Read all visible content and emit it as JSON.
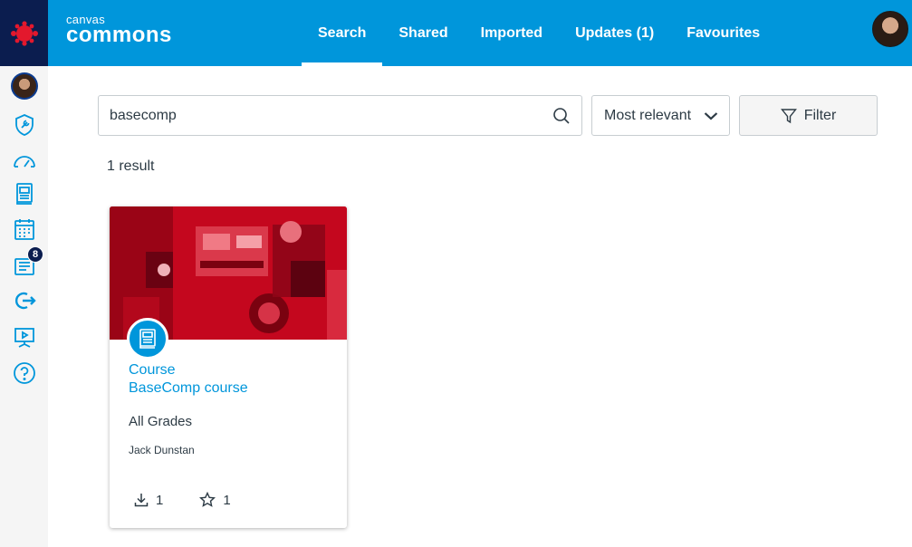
{
  "nav": {
    "logo_icon": "canvas-logo-icon",
    "items": [
      {
        "name": "account-avatar",
        "icon": "avatar"
      },
      {
        "name": "admin",
        "icon": "shield-wrench-icon"
      },
      {
        "name": "dashboard",
        "icon": "speedometer-icon"
      },
      {
        "name": "courses",
        "icon": "book-icon"
      },
      {
        "name": "calendar",
        "icon": "calendar-icon"
      },
      {
        "name": "inbox",
        "icon": "inbox-icon",
        "badge": "8"
      },
      {
        "name": "commons",
        "icon": "commons-arrow-icon"
      },
      {
        "name": "studio",
        "icon": "presentation-icon"
      },
      {
        "name": "help",
        "icon": "help-icon"
      }
    ],
    "accent": "#0096db",
    "logo_bg": "#0b1d4f"
  },
  "header": {
    "brand_small": "canvas",
    "brand_big": "commons",
    "tabs": [
      "Search",
      "Shared",
      "Imported",
      "Updates (1)",
      "Favourites"
    ],
    "active_tab": "Search",
    "bg": "#0096db"
  },
  "search": {
    "value": "basecomp",
    "sort_label": "Most relevant",
    "filter_label": "Filter",
    "result_count": "1 result"
  },
  "results": [
    {
      "type": "Course",
      "title": "BaseComp course",
      "grades": "All Grades",
      "author": "Jack Dunstan",
      "downloads": "1",
      "favourites": "1"
    }
  ]
}
